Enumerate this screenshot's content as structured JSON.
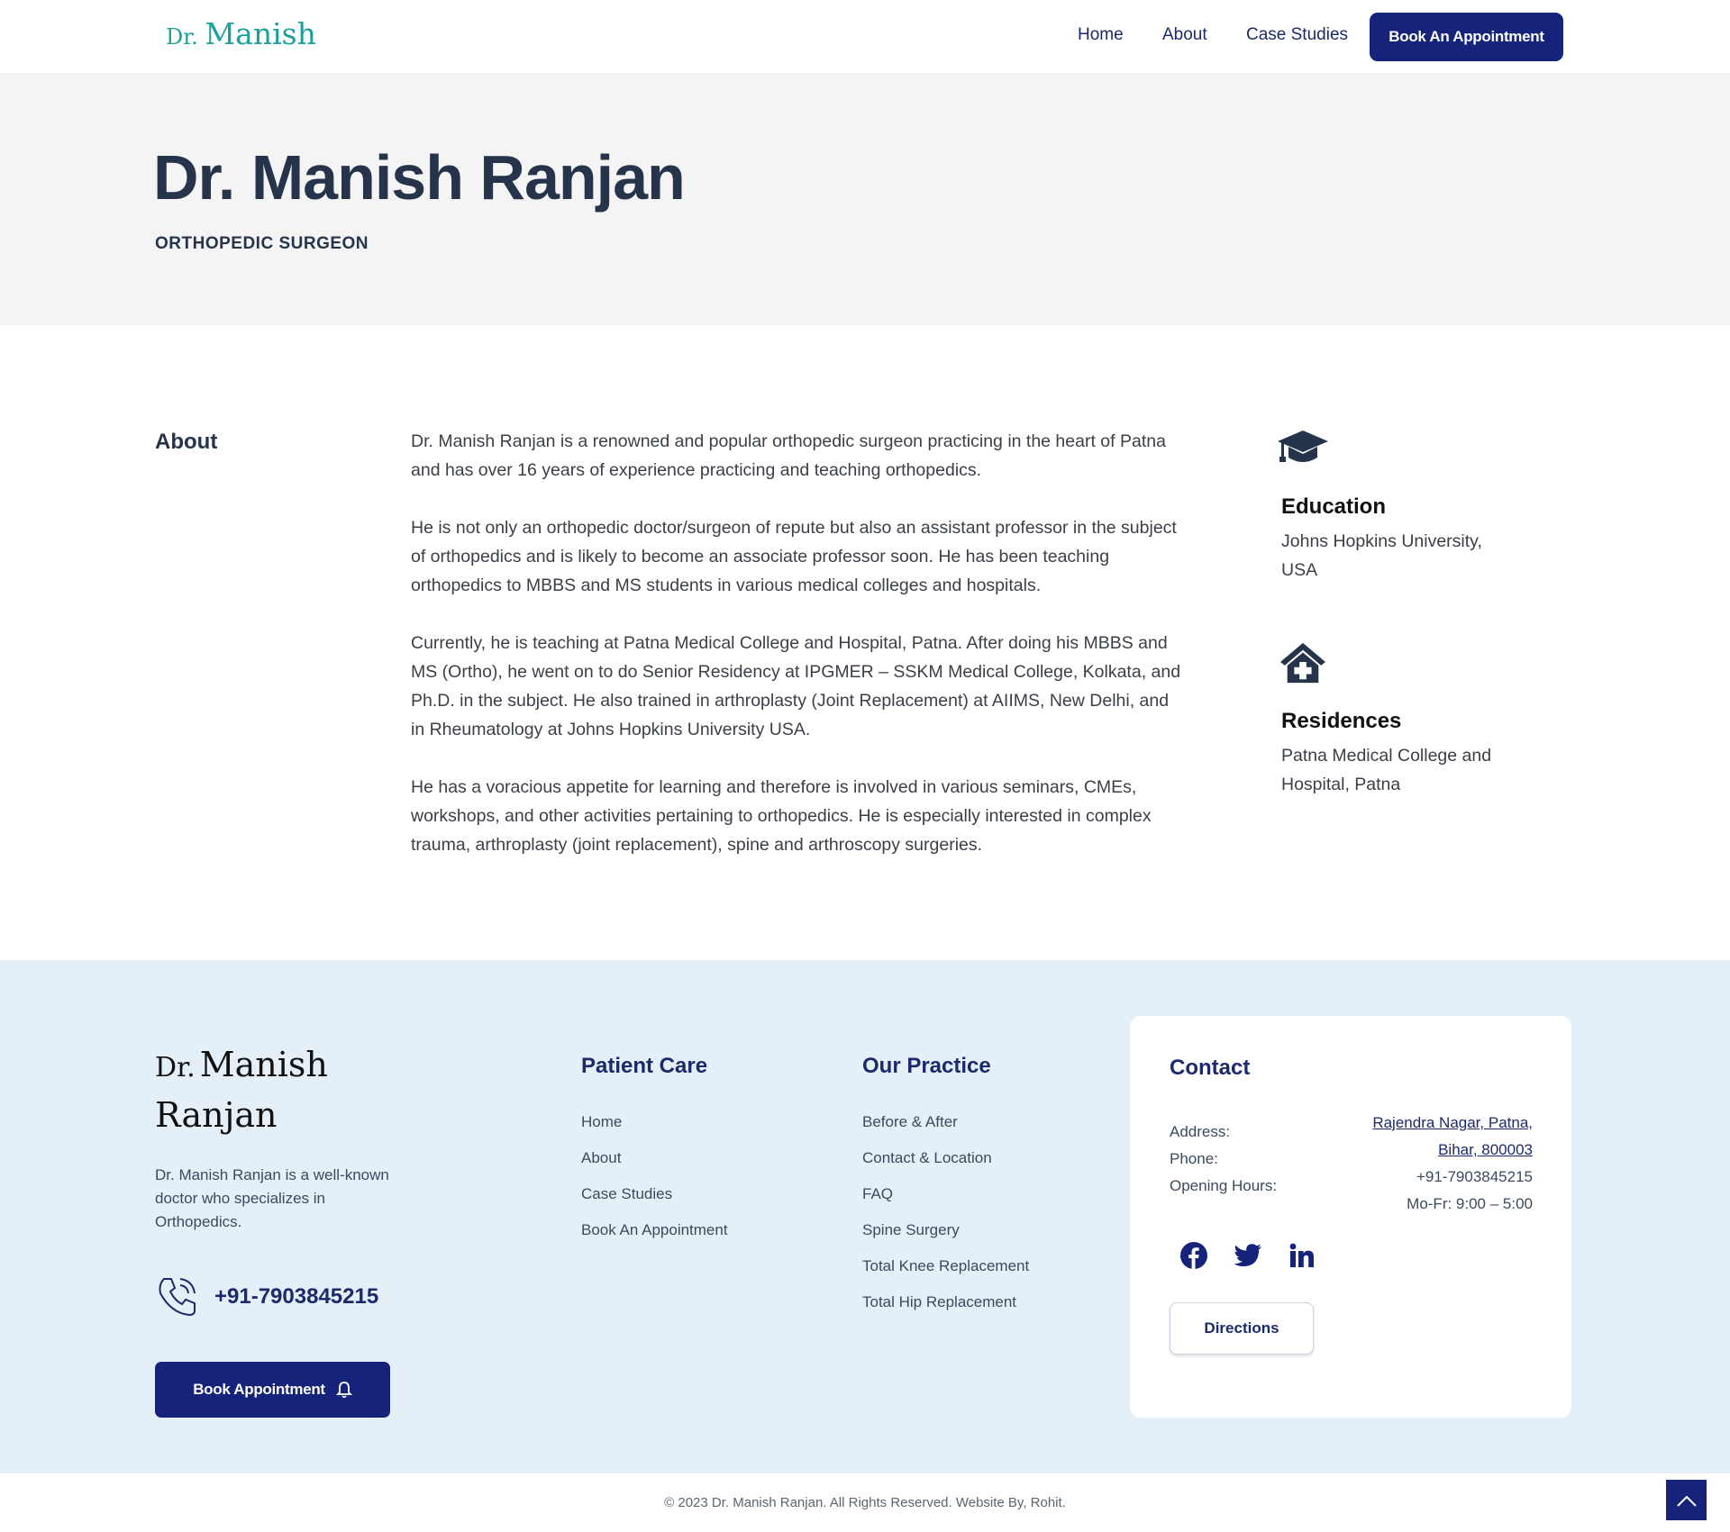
{
  "header": {
    "logo_small": "Dr.",
    "logo_big": "Manish",
    "nav": [
      "Home",
      "About",
      "Case Studies"
    ],
    "cta": "Book An Appointment"
  },
  "hero": {
    "name": "Dr. Manish Ranjan",
    "subtitle": "ORTHOPEDIC SURGEON"
  },
  "about": {
    "heading": "About",
    "paragraphs": [
      "Dr. Manish Ranjan is a renowned and popular orthopedic surgeon practicing in the heart of Patna and has over 16 years of experience practicing and teaching orthopedics.",
      "He is not only an orthopedic doctor/surgeon of repute but also an assistant professor in the subject of orthopedics and is likely to become an associate professor soon. He has been teaching orthopedics to MBBS and MS students in various medical colleges and hospitals.",
      "Currently, he is teaching at Patna Medical College and Hospital, Patna. After doing his MBBS and MS (Ortho), he went on to do Senior Residency at IPGMER – SSKM Medical College, Kolkata, and Ph.D. in the subject. He also trained in arthroplasty (Joint Replacement) at AIIMS, New Delhi, and in Rheumatology at Johns Hopkins University USA.",
      "He has a voracious appetite for learning and therefore is involved in various seminars, CMEs, workshops, and other activities pertaining to orthopedics. He is especially interested in complex trauma, arthroplasty (joint replacement), spine and arthroscopy surgeries."
    ]
  },
  "sidebar": {
    "education": {
      "icon": "graduation-cap-icon",
      "title": "Education",
      "text": "Johns Hopkins University, USA"
    },
    "residences": {
      "icon": "hospital-house-icon",
      "title": "Residences",
      "text": "Patna Medical College and Hospital, Patna"
    }
  },
  "footer": {
    "logo_small": "Dr.",
    "logo_big": "Manish",
    "logo_line2": "Ranjan",
    "description": "Dr. Manish Ranjan is a well-known doctor who specializes in Orthopedics.",
    "phone": "+91-7903845215",
    "book_button": "Book Appointment",
    "patient_care": {
      "heading": "Patient Care",
      "links": [
        "Home",
        "About",
        "Case Studies",
        "Book An Appointment"
      ]
    },
    "our_practice": {
      "heading": "Our Practice",
      "links": [
        "Before & After",
        "Contact & Location",
        "FAQ",
        "Spine Surgery",
        "Total Knee Replacement",
        "Total Hip Replacement"
      ]
    },
    "contact": {
      "heading": "Contact",
      "address_label": "Address:",
      "phone_label": "Phone:",
      "hours_label": "Opening Hours:",
      "address_line1": "Rajendra Nagar, Patna,",
      "address_line2": "Bihar, 800003",
      "phone": "+91-7903845215",
      "hours": "Mo-Fr: 9:00 – 5:00",
      "directions": "Directions"
    },
    "copyright": "© 2023 Dr. Manish Ranjan. All Rights Reserved. Website By, Rohit."
  },
  "colors": {
    "navy": "#15237a",
    "teal": "#1aa19a",
    "hero_bg": "#f4f4f4",
    "footer_bg": "#e5eff7"
  }
}
